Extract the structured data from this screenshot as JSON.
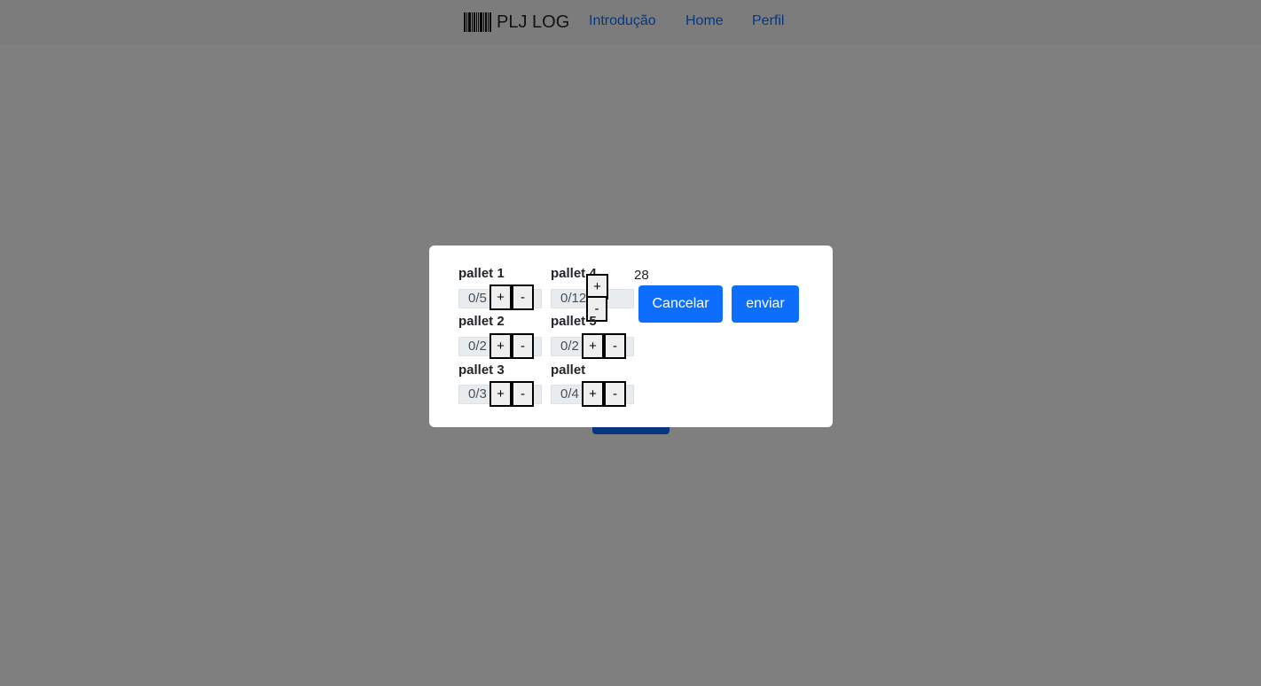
{
  "navbar": {
    "brand": "PLJ LOG",
    "links": [
      "Introdução",
      "Home",
      "Perfil"
    ]
  },
  "modal": {
    "total": "28",
    "pallets": [
      {
        "label": "pallet 1",
        "value": "0/5"
      },
      {
        "label": "pallet 2",
        "value": "0/2"
      },
      {
        "label": "pallet 3",
        "value": "0/3"
      },
      {
        "label": "pallet 4",
        "value": "0/12"
      },
      {
        "label": "pallet 5",
        "value": "0/2"
      },
      {
        "label": "pallet",
        "value": "0/4"
      }
    ],
    "plus_label": "+",
    "minus_label": "-",
    "cancel_label": "Cancelar",
    "send_label": "enviar"
  },
  "colors": {
    "primary": "#0d6efd",
    "overlay": "rgba(0,0,0,0.5)",
    "field_bg": "#e9ecef"
  }
}
